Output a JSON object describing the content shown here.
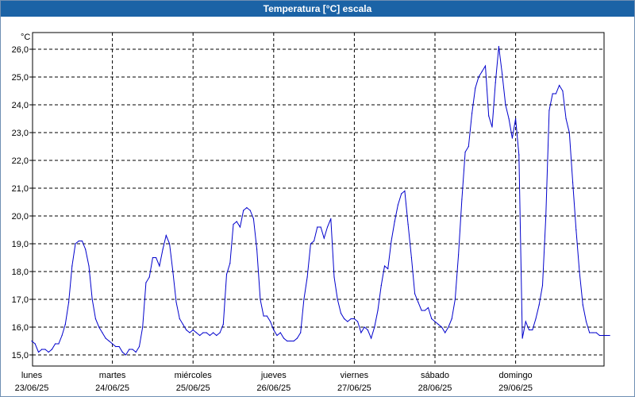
{
  "window": {
    "title": "Temperatura [°C] escala"
  },
  "colors": {
    "title_bar": "#1b63a6",
    "series_line": "#0000cc",
    "grid": "#000000",
    "background": "#ffffff"
  },
  "chart_data": {
    "type": "line",
    "title": "Temperatura [°C] escala",
    "ylabel": "°C",
    "ylim": [
      14.6,
      26.6
    ],
    "yticks": [
      "15,0",
      "16,0",
      "17,0",
      "18,0",
      "19,0",
      "20,0",
      "21,0",
      "22,0",
      "23,0",
      "24,0",
      "25,0",
      "26,0"
    ],
    "ytick_values": [
      15,
      16,
      17,
      18,
      19,
      20,
      21,
      22,
      23,
      24,
      25,
      26
    ],
    "xlim": [
      "2025-06-23 00:00",
      "2025-06-30 04:00"
    ],
    "xticks": [
      {
        "day": "lunes",
        "date": "23/06/25"
      },
      {
        "day": "martes",
        "date": "24/06/25"
      },
      {
        "day": "miércoles",
        "date": "25/06/25"
      },
      {
        "day": "jueves",
        "date": "26/06/25"
      },
      {
        "day": "viernes",
        "date": "27/06/25"
      },
      {
        "day": "sábado",
        "date": "28/06/25"
      },
      {
        "day": "domingo",
        "date": "29/06/25"
      }
    ],
    "grid": true,
    "series": [
      {
        "x": [
          "2025-06-23 00:00",
          "2025-06-23 01:00",
          "2025-06-23 02:00",
          "2025-06-23 03:00",
          "2025-06-23 04:00",
          "2025-06-23 05:00",
          "2025-06-23 06:00",
          "2025-06-23 07:00",
          "2025-06-23 08:00",
          "2025-06-23 09:00",
          "2025-06-23 10:00",
          "2025-06-23 11:00",
          "2025-06-23 12:00",
          "2025-06-23 13:00",
          "2025-06-23 14:00",
          "2025-06-23 15:00",
          "2025-06-23 16:00",
          "2025-06-23 17:00",
          "2025-06-23 18:00",
          "2025-06-23 19:00",
          "2025-06-23 20:00",
          "2025-06-23 21:00",
          "2025-06-23 22:00",
          "2025-06-23 23:00",
          "2025-06-24 00:00",
          "2025-06-24 01:00",
          "2025-06-24 02:00",
          "2025-06-24 03:00",
          "2025-06-24 04:00",
          "2025-06-24 05:00",
          "2025-06-24 06:00",
          "2025-06-24 07:00",
          "2025-06-24 08:00",
          "2025-06-24 09:00",
          "2025-06-24 10:00",
          "2025-06-24 11:00",
          "2025-06-24 12:00",
          "2025-06-24 13:00",
          "2025-06-24 14:00",
          "2025-06-24 15:00",
          "2025-06-24 16:00",
          "2025-06-24 17:00",
          "2025-06-24 18:00",
          "2025-06-24 19:00",
          "2025-06-24 20:00",
          "2025-06-24 21:00",
          "2025-06-24 22:00",
          "2025-06-24 23:00",
          "2025-06-25 00:00",
          "2025-06-25 01:00",
          "2025-06-25 02:00",
          "2025-06-25 03:00",
          "2025-06-25 04:00",
          "2025-06-25 05:00",
          "2025-06-25 06:00",
          "2025-06-25 07:00",
          "2025-06-25 08:00",
          "2025-06-25 09:00",
          "2025-06-25 10:00",
          "2025-06-25 11:00",
          "2025-06-25 12:00",
          "2025-06-25 13:00",
          "2025-06-25 14:00",
          "2025-06-25 15:00",
          "2025-06-25 16:00",
          "2025-06-25 17:00",
          "2025-06-25 18:00",
          "2025-06-25 19:00",
          "2025-06-25 20:00",
          "2025-06-25 21:00",
          "2025-06-25 22:00",
          "2025-06-25 23:00",
          "2025-06-26 00:00",
          "2025-06-26 01:00",
          "2025-06-26 02:00",
          "2025-06-26 03:00",
          "2025-06-26 04:00",
          "2025-06-26 05:00",
          "2025-06-26 06:00",
          "2025-06-26 07:00",
          "2025-06-26 08:00",
          "2025-06-26 09:00",
          "2025-06-26 10:00",
          "2025-06-26 11:00",
          "2025-06-26 12:00",
          "2025-06-26 13:00",
          "2025-06-26 14:00",
          "2025-06-26 15:00",
          "2025-06-26 16:00",
          "2025-06-26 17:00",
          "2025-06-26 18:00",
          "2025-06-26 19:00",
          "2025-06-26 20:00",
          "2025-06-26 21:00",
          "2025-06-26 22:00",
          "2025-06-26 23:00",
          "2025-06-27 00:00",
          "2025-06-27 01:00",
          "2025-06-27 02:00",
          "2025-06-27 03:00",
          "2025-06-27 04:00",
          "2025-06-27 05:00",
          "2025-06-27 06:00",
          "2025-06-27 07:00",
          "2025-06-27 08:00",
          "2025-06-27 09:00",
          "2025-06-27 10:00",
          "2025-06-27 11:00",
          "2025-06-27 12:00",
          "2025-06-27 13:00",
          "2025-06-27 14:00",
          "2025-06-27 15:00",
          "2025-06-27 16:00",
          "2025-06-27 17:00",
          "2025-06-27 18:00",
          "2025-06-27 19:00",
          "2025-06-27 20:00",
          "2025-06-27 21:00",
          "2025-06-27 22:00",
          "2025-06-27 23:00",
          "2025-06-28 00:00",
          "2025-06-28 01:00",
          "2025-06-28 02:00",
          "2025-06-28 03:00",
          "2025-06-28 04:00",
          "2025-06-28 05:00",
          "2025-06-28 06:00",
          "2025-06-28 07:00",
          "2025-06-28 08:00",
          "2025-06-28 09:00",
          "2025-06-28 10:00",
          "2025-06-28 11:00",
          "2025-06-28 12:00",
          "2025-06-28 13:00",
          "2025-06-28 14:00",
          "2025-06-28 15:00",
          "2025-06-28 16:00",
          "2025-06-28 17:00",
          "2025-06-28 18:00",
          "2025-06-28 19:00",
          "2025-06-28 20:00",
          "2025-06-28 21:00",
          "2025-06-28 22:00",
          "2025-06-28 23:00",
          "2025-06-29 00:00",
          "2025-06-29 01:00",
          "2025-06-29 02:00",
          "2025-06-29 03:00",
          "2025-06-29 04:00",
          "2025-06-29 05:00",
          "2025-06-29 06:00",
          "2025-06-29 07:00",
          "2025-06-29 08:00",
          "2025-06-29 09:00",
          "2025-06-29 10:00",
          "2025-06-29 11:00",
          "2025-06-29 12:00",
          "2025-06-29 13:00",
          "2025-06-29 14:00",
          "2025-06-29 15:00",
          "2025-06-29 16:00",
          "2025-06-29 17:00",
          "2025-06-29 18:00",
          "2025-06-29 19:00",
          "2025-06-29 20:00",
          "2025-06-29 21:00",
          "2025-06-29 22:00",
          "2025-06-29 23:00",
          "2025-06-30 00:00",
          "2025-06-30 01:00",
          "2025-06-30 02:00",
          "2025-06-30 03:00",
          "2025-06-30 04:00"
        ],
        "values": [
          15.5,
          15.4,
          15.1,
          15.2,
          15.2,
          15.1,
          15.2,
          15.4,
          15.4,
          15.7,
          16.1,
          16.9,
          18.2,
          19.0,
          19.1,
          19.1,
          18.8,
          18.2,
          17.0,
          16.3,
          16.0,
          15.8,
          15.6,
          15.5,
          15.4,
          15.3,
          15.3,
          15.1,
          15.0,
          15.2,
          15.2,
          15.1,
          15.3,
          16.0,
          17.6,
          17.8,
          18.5,
          18.5,
          18.2,
          18.8,
          19.3,
          19.0,
          18.0,
          16.9,
          16.3,
          16.1,
          15.9,
          15.8,
          15.9,
          15.8,
          15.7,
          15.8,
          15.8,
          15.7,
          15.8,
          15.7,
          15.8,
          16.1,
          17.9,
          18.3,
          19.7,
          19.8,
          19.6,
          20.2,
          20.3,
          20.2,
          19.9,
          18.8,
          17.0,
          16.4,
          16.4,
          16.2,
          15.9,
          15.7,
          15.8,
          15.6,
          15.5,
          15.5,
          15.5,
          15.6,
          15.8,
          17.0,
          17.8,
          19.0,
          19.1,
          19.6,
          19.6,
          19.2,
          19.6,
          19.9,
          17.8,
          17.0,
          16.5,
          16.3,
          16.2,
          16.3,
          16.3,
          16.2,
          15.8,
          16.0,
          15.9,
          15.6,
          16.0,
          16.6,
          17.5,
          18.2,
          18.1,
          19.1,
          19.8,
          20.4,
          20.8,
          20.9,
          19.7,
          18.5,
          17.2,
          16.9,
          16.6,
          16.6,
          16.7,
          16.3,
          16.2,
          16.1,
          16.0,
          15.8,
          16.0,
          16.3,
          17.0,
          18.6,
          20.6,
          22.3,
          22.5,
          23.7,
          24.6,
          25.0,
          25.2,
          25.4,
          23.6,
          23.2,
          24.8,
          26.1,
          25.1,
          24.0,
          23.5,
          22.8,
          23.5,
          22.2,
          15.6,
          16.2,
          15.9,
          15.9,
          16.3,
          16.8,
          17.5,
          20.0,
          23.8,
          24.4,
          24.4,
          24.7,
          24.5,
          23.5,
          23.0,
          21.2,
          19.5,
          18.0,
          16.8,
          16.2,
          15.8,
          15.8,
          15.8,
          15.7,
          15.7,
          15.7,
          15.7
        ]
      }
    ]
  }
}
